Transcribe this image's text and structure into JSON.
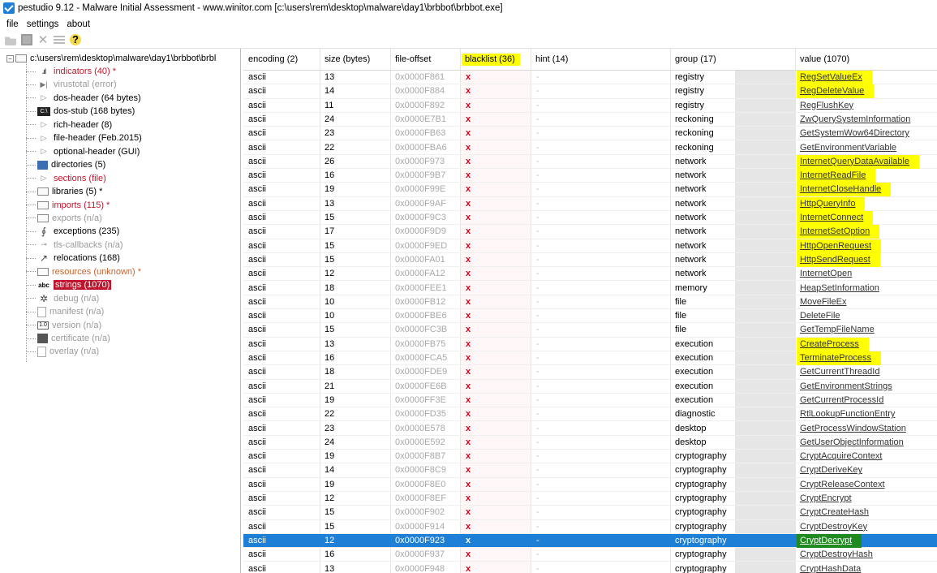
{
  "window": {
    "title": "pestudio 9.12 - Malware Initial Assessment - www.winitor.com [c:\\users\\rem\\desktop\\malware\\day1\\brbbot\\brbbot.exe]"
  },
  "menu": [
    "file",
    "settings",
    "about"
  ],
  "toolbar": {
    "icons": [
      "open-icon",
      "save-icon",
      "close-icon",
      "list-icon",
      "help-icon"
    ],
    "help_glyph": "?",
    "close_glyph": "✕"
  },
  "tree": {
    "root": "c:\\users\\rem\\desktop\\malware\\day1\\brbbot\\brbl",
    "items": [
      {
        "label": "indicators (40) *",
        "style": "red",
        "icon": "indicators-icon",
        "glyph": ".ıl"
      },
      {
        "label": "virustotal (error)",
        "style": "gray",
        "icon": "virustotal-icon",
        "glyph": "▶|"
      },
      {
        "label": "dos-header (64 bytes)",
        "style": "normal",
        "icon": "arrow-icon",
        "glyph": "▷"
      },
      {
        "label": "dos-stub (168 bytes)",
        "style": "normal",
        "icon": "console-icon",
        "glyph": "C:\\"
      },
      {
        "label": "rich-header (8)",
        "style": "normal",
        "icon": "arrow-icon",
        "glyph": "▷"
      },
      {
        "label": "file-header (Feb.2015)",
        "style": "normal",
        "icon": "arrow-icon",
        "glyph": "▷"
      },
      {
        "label": "optional-header (GUI)",
        "style": "normal",
        "icon": "arrow-icon",
        "glyph": "▷"
      },
      {
        "label": "directories (5)",
        "style": "normal",
        "icon": "directories-icon",
        "glyph": ""
      },
      {
        "label": "sections (file)",
        "style": "red",
        "icon": "arrow-icon",
        "glyph": "▷"
      },
      {
        "label": "libraries (5) *",
        "style": "normal",
        "icon": "library-icon",
        "glyph": ""
      },
      {
        "label": "imports (115) *",
        "style": "red",
        "icon": "imports-icon",
        "glyph": ""
      },
      {
        "label": "exports (n/a)",
        "style": "gray",
        "icon": "exports-icon",
        "glyph": ""
      },
      {
        "label": "exceptions (235)",
        "style": "normal",
        "icon": "exceptions-icon",
        "glyph": "∮"
      },
      {
        "label": "tls-callbacks (n/a)",
        "style": "gray",
        "icon": "tls-icon",
        "glyph": "⊸"
      },
      {
        "label": "relocations (168)",
        "style": "normal",
        "icon": "relocations-icon",
        "glyph": "↗"
      },
      {
        "label": "resources (unknown) *",
        "style": "orange",
        "icon": "resources-icon",
        "glyph": ""
      },
      {
        "label": "strings (1070)",
        "style": "selected",
        "icon": "strings-icon",
        "glyph": "abc"
      },
      {
        "label": "debug (n/a)",
        "style": "gray",
        "icon": "debug-icon",
        "glyph": "✲"
      },
      {
        "label": "manifest (n/a)",
        "style": "gray",
        "icon": "manifest-icon",
        "glyph": ""
      },
      {
        "label": "version (n/a)",
        "style": "gray",
        "icon": "version-icon",
        "glyph": "1.0"
      },
      {
        "label": "certificate (n/a)",
        "style": "gray",
        "icon": "certificate-icon",
        "glyph": ""
      },
      {
        "label": "overlay (n/a)",
        "style": "gray",
        "icon": "overlay-icon",
        "glyph": ""
      }
    ]
  },
  "table": {
    "columns": [
      "encoding (2)",
      "size (bytes)",
      "file-offset",
      "blacklist (36)",
      "hint (14)",
      "group (17)",
      "value (1070)"
    ],
    "rows": [
      {
        "enc": "ascii",
        "size": "13",
        "off": "0x0000F861",
        "bl": "x",
        "hint": "-",
        "group": "registry",
        "value": "RegSetValueEx",
        "hl": true
      },
      {
        "enc": "ascii",
        "size": "14",
        "off": "0x0000F884",
        "bl": "x",
        "hint": "-",
        "group": "registry",
        "value": "RegDeleteValue",
        "hl": true
      },
      {
        "enc": "ascii",
        "size": "11",
        "off": "0x0000F892",
        "bl": "x",
        "hint": "-",
        "group": "registry",
        "value": "RegFlushKey",
        "hl": false
      },
      {
        "enc": "ascii",
        "size": "24",
        "off": "0x0000E7B1",
        "bl": "x",
        "hint": "-",
        "group": "reckoning",
        "value": "ZwQuerySystemInformation",
        "hl": false
      },
      {
        "enc": "ascii",
        "size": "23",
        "off": "0x0000FB63",
        "bl": "x",
        "hint": "-",
        "group": "reckoning",
        "value": "GetSystemWow64Directory",
        "hl": false
      },
      {
        "enc": "ascii",
        "size": "22",
        "off": "0x0000FBA6",
        "bl": "x",
        "hint": "-",
        "group": "reckoning",
        "value": "GetEnvironmentVariable",
        "hl": false
      },
      {
        "enc": "ascii",
        "size": "26",
        "off": "0x0000F973",
        "bl": "x",
        "hint": "-",
        "group": "network",
        "value": "InternetQueryDataAvailable",
        "hl": true
      },
      {
        "enc": "ascii",
        "size": "16",
        "off": "0x0000F9B7",
        "bl": "x",
        "hint": "-",
        "group": "network",
        "value": "InternetReadFile",
        "hl": true
      },
      {
        "enc": "ascii",
        "size": "19",
        "off": "0x0000F99E",
        "bl": "x",
        "hint": "-",
        "group": "network",
        "value": "InternetCloseHandle",
        "hl": true
      },
      {
        "enc": "ascii",
        "size": "13",
        "off": "0x0000F9AF",
        "bl": "x",
        "hint": "-",
        "group": "network",
        "value": "HttpQueryInfo",
        "hl": true
      },
      {
        "enc": "ascii",
        "size": "15",
        "off": "0x0000F9C3",
        "bl": "x",
        "hint": "-",
        "group": "network",
        "value": "InternetConnect",
        "hl": true
      },
      {
        "enc": "ascii",
        "size": "17",
        "off": "0x0000F9D9",
        "bl": "x",
        "hint": "-",
        "group": "network",
        "value": "InternetSetOption",
        "hl": true
      },
      {
        "enc": "ascii",
        "size": "15",
        "off": "0x0000F9ED",
        "bl": "x",
        "hint": "-",
        "group": "network",
        "value": "HttpOpenRequest",
        "hl": true
      },
      {
        "enc": "ascii",
        "size": "15",
        "off": "0x0000FA01",
        "bl": "x",
        "hint": "-",
        "group": "network",
        "value": "HttpSendRequest",
        "hl": true
      },
      {
        "enc": "ascii",
        "size": "12",
        "off": "0x0000FA12",
        "bl": "x",
        "hint": "-",
        "group": "network",
        "value": "InternetOpen",
        "hl": false
      },
      {
        "enc": "ascii",
        "size": "18",
        "off": "0x0000FEE1",
        "bl": "x",
        "hint": "-",
        "group": "memory",
        "value": "HeapSetInformation",
        "hl": false
      },
      {
        "enc": "ascii",
        "size": "10",
        "off": "0x0000FB12",
        "bl": "x",
        "hint": "-",
        "group": "file",
        "value": "MoveFileEx",
        "hl": false
      },
      {
        "enc": "ascii",
        "size": "10",
        "off": "0x0000FBE6",
        "bl": "x",
        "hint": "-",
        "group": "file",
        "value": "DeleteFile",
        "hl": false
      },
      {
        "enc": "ascii",
        "size": "15",
        "off": "0x0000FC3B",
        "bl": "x",
        "hint": "-",
        "group": "file",
        "value": "GetTempFileName",
        "hl": false
      },
      {
        "enc": "ascii",
        "size": "13",
        "off": "0x0000FB75",
        "bl": "x",
        "hint": "-",
        "group": "execution",
        "value": "CreateProcess",
        "hl": true
      },
      {
        "enc": "ascii",
        "size": "16",
        "off": "0x0000FCA5",
        "bl": "x",
        "hint": "-",
        "group": "execution",
        "value": "TerminateProcess",
        "hl": true
      },
      {
        "enc": "ascii",
        "size": "18",
        "off": "0x0000FDE9",
        "bl": "x",
        "hint": "-",
        "group": "execution",
        "value": "GetCurrentThreadId",
        "hl": false
      },
      {
        "enc": "ascii",
        "size": "21",
        "off": "0x0000FE6B",
        "bl": "x",
        "hint": "-",
        "group": "execution",
        "value": "GetEnvironmentStrings",
        "hl": false
      },
      {
        "enc": "ascii",
        "size": "19",
        "off": "0x0000FF3E",
        "bl": "x",
        "hint": "-",
        "group": "execution",
        "value": "GetCurrentProcessId",
        "hl": false
      },
      {
        "enc": "ascii",
        "size": "22",
        "off": "0x0000FD35",
        "bl": "x",
        "hint": "-",
        "group": "diagnostic",
        "value": "RtlLookupFunctionEntry",
        "hl": false
      },
      {
        "enc": "ascii",
        "size": "23",
        "off": "0x0000E578",
        "bl": "x",
        "hint": "-",
        "group": "desktop",
        "value": "GetProcessWindowStation",
        "hl": false
      },
      {
        "enc": "ascii",
        "size": "24",
        "off": "0x0000E592",
        "bl": "x",
        "hint": "-",
        "group": "desktop",
        "value": "GetUserObjectInformation",
        "hl": false
      },
      {
        "enc": "ascii",
        "size": "19",
        "off": "0x0000F8B7",
        "bl": "x",
        "hint": "-",
        "group": "cryptography",
        "value": "CryptAcquireContext",
        "hl": false
      },
      {
        "enc": "ascii",
        "size": "14",
        "off": "0x0000F8C9",
        "bl": "x",
        "hint": "-",
        "group": "cryptography",
        "value": "CryptDeriveKey",
        "hl": false
      },
      {
        "enc": "ascii",
        "size": "19",
        "off": "0x0000F8E0",
        "bl": "x",
        "hint": "-",
        "group": "cryptography",
        "value": "CryptReleaseContext",
        "hl": false
      },
      {
        "enc": "ascii",
        "size": "12",
        "off": "0x0000F8EF",
        "bl": "x",
        "hint": "-",
        "group": "cryptography",
        "value": "CryptEncrypt",
        "hl": false
      },
      {
        "enc": "ascii",
        "size": "15",
        "off": "0x0000F902",
        "bl": "x",
        "hint": "-",
        "group": "cryptography",
        "value": "CryptCreateHash",
        "hl": false
      },
      {
        "enc": "ascii",
        "size": "15",
        "off": "0x0000F914",
        "bl": "x",
        "hint": "-",
        "group": "cryptography",
        "value": "CryptDestroyKey",
        "hl": false
      },
      {
        "enc": "ascii",
        "size": "12",
        "off": "0x0000F923",
        "bl": "x",
        "hint": "-",
        "group": "cryptography",
        "value": "CryptDecrypt",
        "hl": true,
        "selected": true
      },
      {
        "enc": "ascii",
        "size": "16",
        "off": "0x0000F937",
        "bl": "x",
        "hint": "-",
        "group": "cryptography",
        "value": "CryptDestroyHash",
        "hl": false
      },
      {
        "enc": "ascii",
        "size": "13",
        "off": "0x0000F948",
        "bl": "x",
        "hint": "-",
        "group": "cryptography",
        "value": "CryptHashData",
        "hl": false
      }
    ]
  },
  "colors": {
    "highlight": "#ffff00",
    "selection": "#1e7fd6",
    "selection_value": "#1f8a1f",
    "alert_red": "#c0162d",
    "blacklist_x": "#d0021b"
  }
}
